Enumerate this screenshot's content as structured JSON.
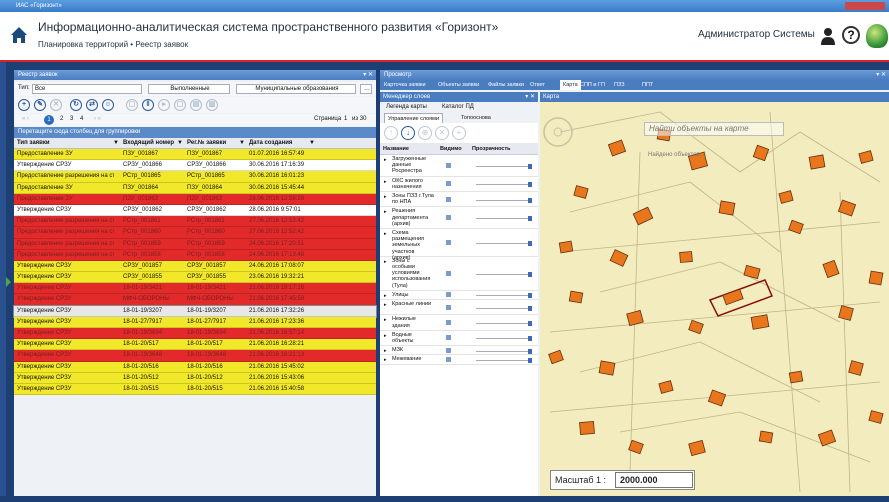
{
  "window": {
    "title": "ИАС «Горизонт»"
  },
  "header": {
    "title": "Информационно-аналитическая система пространственного развития «Горизонт»",
    "breadcrumb": [
      "Планировка территорий",
      "Реестр заявок"
    ],
    "user": "Администратор Системы",
    "help": "?"
  },
  "registry": {
    "panel_title": "Реестр заявок",
    "type_label": "Тип:",
    "type_value": "Все",
    "status_value": "Выполненные",
    "org_value": "Муниципальные образования",
    "pager": {
      "pages": [
        "1",
        "2",
        "3",
        "4"
      ],
      "current": "1",
      "page_label": "Страница",
      "page_value": "1",
      "of_label": "из 30"
    },
    "group_hint": "Перетащите сюда столбец для группировки",
    "columns": [
      "Тип заявки",
      "Входящий номер",
      "Рег.№ заявки",
      "Дата создания"
    ],
    "rows": [
      {
        "type": "Предоставление ЗУ",
        "in": "ПЗУ_001867",
        "reg": "ПЗУ_001867",
        "date": "01.07.2016 16:57:49",
        "color": "yellow"
      },
      {
        "type": "Утверждение СРЗУ",
        "in": "СРЗУ_001866",
        "reg": "СРЗУ_001866",
        "date": "30.06.2016 17:16:39",
        "color": "white"
      },
      {
        "type": "Предоставление разрешения на строительство",
        "in": "РСтр_001865",
        "reg": "РСтр_001865",
        "date": "30.06.2016 16:01:23",
        "color": "yellow"
      },
      {
        "type": "Предоставление ЗУ",
        "in": "ПЗУ_001864",
        "reg": "ПЗУ_001864",
        "date": "30.06.2016 15:45:44",
        "color": "yellow"
      },
      {
        "type": "Предоставление ЗУ",
        "in": "ПЗУ_001863",
        "reg": "ПЗУ_001863",
        "date": "28.06.2016 12:59:28",
        "color": "red"
      },
      {
        "type": "Утверждение СРЗУ",
        "in": "СРЗУ_001862",
        "reg": "СРЗУ_001862",
        "date": "28.06.2016 9:57:01",
        "color": "white"
      },
      {
        "type": "Предоставление разрешения на строительство",
        "in": "РСтр_001861",
        "reg": "РСтр_001861",
        "date": "27.06.2016 12:53:42",
        "color": "red"
      },
      {
        "type": "Предоставление разрешения на строительство",
        "in": "РСтр_001860",
        "reg": "РСтр_001860",
        "date": "27.06.2016 12:52:42",
        "color": "red"
      },
      {
        "type": "Предоставление разрешения на строительство",
        "in": "РСтр_001859",
        "reg": "РСтр_001859",
        "date": "24.06.2016 17:20:51",
        "color": "red"
      },
      {
        "type": "Предоставление разрешения на строительство",
        "in": "РСтр_001858",
        "reg": "РСтр_001858",
        "date": "24.06.2016 17:13:48",
        "color": "red"
      },
      {
        "type": "Утверждение СРЗУ",
        "in": "СРЗУ_001857",
        "reg": "СРЗУ_001857",
        "date": "24.06.2016 17:08:07",
        "color": "yellow"
      },
      {
        "type": "Утверждение СРЗУ",
        "in": "СРЗУ_001855",
        "reg": "СРЗУ_001855",
        "date": "23.06.2016 19:32:21",
        "color": "yellow"
      },
      {
        "type": "Утверждение СРЗУ",
        "in": "18-01-19/3421",
        "reg": "18-01-19/3421",
        "date": "21.06.2016 18:17:16",
        "color": "red"
      },
      {
        "type": "Утверждение СРЗУ",
        "in": "МФЧ-ОБОРОНЫ",
        "reg": "МФЧ-ОБОРОНЫ",
        "date": "21.06.2016 17:45:58",
        "color": "red"
      },
      {
        "type": "Утверждение СРЗУ",
        "in": "18-01-19/3207",
        "reg": "18-01-19/3207",
        "date": "21.06.2016 17:32:26",
        "color": "sel"
      },
      {
        "type": "Утверждение СРЗУ",
        "in": "18-01-27/7917",
        "reg": "18-01-27/7917",
        "date": "21.06.2016 17:23:36",
        "color": "yellow"
      },
      {
        "type": "Утверждение СРЗУ",
        "in": "18-01-19/3694",
        "reg": "18-01-19/3694",
        "date": "21.06.2016 16:57:14",
        "color": "red"
      },
      {
        "type": "Утверждение СРЗУ",
        "in": "18-01-20/517",
        "reg": "18-01-20/517",
        "date": "21.06.2016 16:28:21",
        "color": "yellow"
      },
      {
        "type": "Утверждение СРЗУ",
        "in": "18-01-19/3648",
        "reg": "18-01-19/3648",
        "date": "21.06.2016 16:21:13",
        "color": "red"
      },
      {
        "type": "Утверждение СРЗУ",
        "in": "18-01-20/516",
        "reg": "18-01-20/516",
        "date": "21.06.2016 15:45:02",
        "color": "yellow"
      },
      {
        "type": "Утверждение СРЗУ",
        "in": "18-01-20/512",
        "reg": "18-01-20/512",
        "date": "21.06.2016 15:43:06",
        "color": "yellow"
      },
      {
        "type": "Утверждение СРЗУ",
        "in": "18-01-20/515",
        "reg": "18-01-20/515",
        "date": "21.06.2016 15:40:58",
        "color": "yellow"
      }
    ]
  },
  "viewer": {
    "panel_title": "Просмотр",
    "tabs": [
      "Карточка заявки",
      "Объекты заявки",
      "Файлы заявки",
      "Ответ",
      "Карта",
      "СПП и ГП",
      "ПЗЗ",
      "ППТ"
    ],
    "active_tab": "Карта"
  },
  "layers": {
    "title": "Менеджер слоев",
    "tabs": [
      "Легенда карты",
      "Каталог ПД"
    ],
    "subtabs": [
      "Управление слоями",
      "Топооснова"
    ],
    "col_name": "Название",
    "col_visible": "Видимо",
    "col_opacity": "Прозрачность",
    "items": [
      {
        "name": "Загруженные данные Росреестра",
        "h": 3
      },
      {
        "name": "ОКС жилого назначения",
        "h": 2
      },
      {
        "name": "Зоны ПЗЗ г.Тула по НПА",
        "h": 2
      },
      {
        "name": "Решения департамента (архив)",
        "h": 3
      },
      {
        "name": "Схема размещения земельных участков (архив)",
        "h": 4
      },
      {
        "name": "Зоны с особыми условиями использования (Тула)",
        "h": 5
      },
      {
        "name": "Улицы",
        "h": 1
      },
      {
        "name": "Красные линии",
        "h": 2
      },
      {
        "name": "Нежилые здания",
        "h": 2
      },
      {
        "name": "Водные объекты",
        "h": 2
      },
      {
        "name": "МЗК",
        "h": 1
      },
      {
        "name": "Межевание",
        "h": 1
      }
    ]
  },
  "map": {
    "title": "Карта",
    "search_placeholder": "Найти объекты на карте",
    "found": "Найдено объектов: 1",
    "scale_label": "Масштаб 1 :",
    "scale_value": "2000.000",
    "accent": "#e8761c"
  }
}
